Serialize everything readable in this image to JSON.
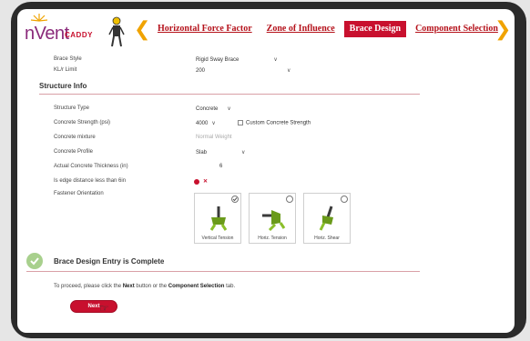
{
  "app": {
    "logo_text": "nVent",
    "logo_sub": "CADDY"
  },
  "tabs": [
    {
      "label": "Horizontal Force Factor",
      "active": false
    },
    {
      "label": "Zone of Influence",
      "active": false
    },
    {
      "label": "Brace Design",
      "active": true
    },
    {
      "label": "Component Selection",
      "active": false
    }
  ],
  "top_fields": {
    "brace_style": {
      "label": "Brace Style",
      "value": "Rigid Sway Brace"
    },
    "kl_limit": {
      "label": "KL/r Limit",
      "value": "200"
    }
  },
  "structure_info": {
    "title": "Structure Info",
    "structure_type": {
      "label": "Structure Type",
      "value": "Concrete"
    },
    "concrete_strength": {
      "label": "Concrete Strength (psi)",
      "value": "4000",
      "custom_label": "Custom Concrete Strength"
    },
    "concrete_mixture": {
      "label": "Concrete mixture",
      "value": "Normal Weight"
    },
    "concrete_profile": {
      "label": "Concrete Profile",
      "value": "Slab"
    },
    "thickness": {
      "label": "Actual Concrete Thickness (in)",
      "value": "6"
    },
    "edge_distance": {
      "label": "Is edge distance less than 6in",
      "x_mark": "✕"
    },
    "fastener_orientation": {
      "label": "Fastener Orientation",
      "options": [
        {
          "caption": "Vertical Tension"
        },
        {
          "caption": "Horiz. Tension"
        },
        {
          "caption": "Horiz. Shear"
        }
      ]
    }
  },
  "completion": {
    "title": "Brace Design Entry is Complete",
    "proceed_prefix": "To proceed, please click the ",
    "proceed_next": "Next",
    "proceed_mid": " button or the ",
    "proceed_tab": "Component Selection",
    "proceed_suffix": " tab.",
    "next_button": "Next"
  },
  "colors": {
    "accent": "#c8102e",
    "chevron": "#f0a300",
    "brand": "#8a2a7a"
  }
}
